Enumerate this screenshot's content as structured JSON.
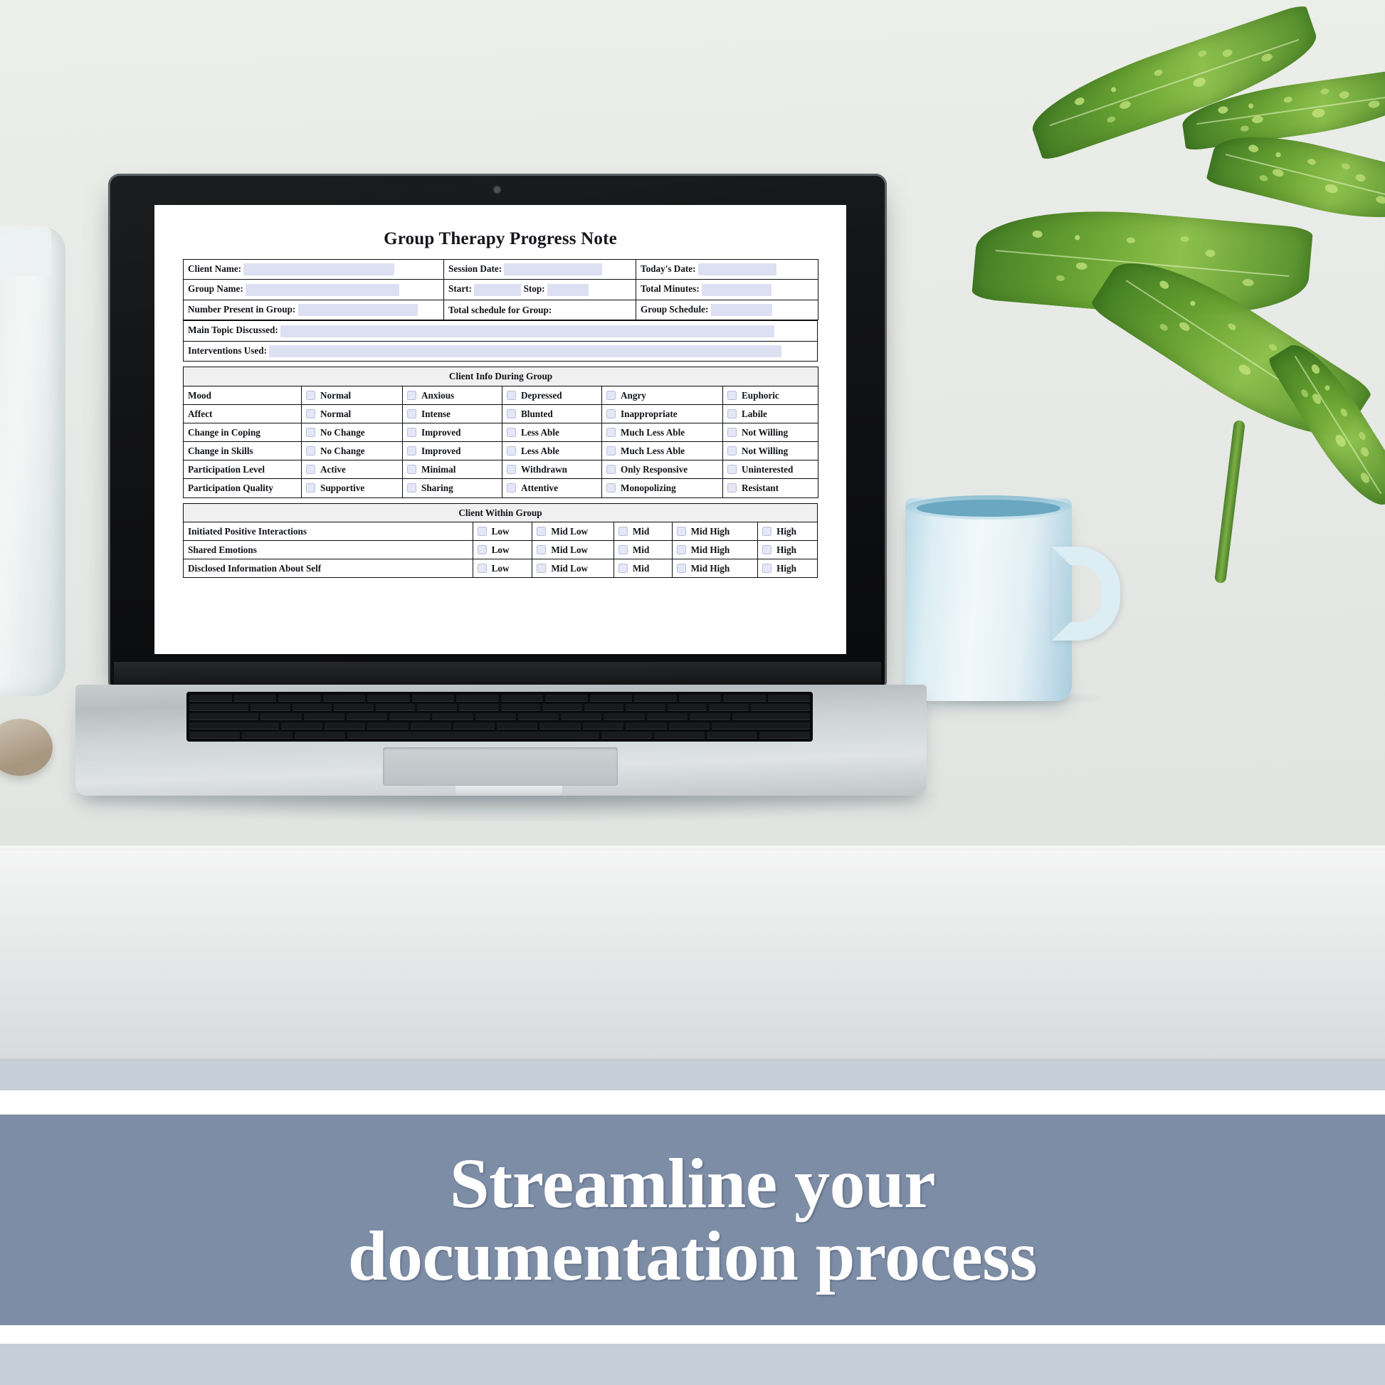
{
  "document": {
    "title": "Group Therapy Progress Note",
    "header_rows": [
      [
        {
          "label": "Client Name:",
          "type": "fill"
        },
        {
          "label": "Session Date:",
          "type": "fill"
        },
        {
          "label": "Today's Date:",
          "type": "fill"
        }
      ],
      [
        {
          "label": "Group Name:",
          "type": "fill"
        },
        {
          "label": "Start:",
          "label2": "Stop:",
          "type": "split"
        },
        {
          "label": "Total Minutes:",
          "type": "fill"
        }
      ],
      [
        {
          "label": "Number Present in Group:",
          "type": "fill"
        },
        {
          "label": "Total schedule for Group:",
          "type": "plain"
        },
        {
          "label": "Group Schedule:",
          "type": "fill"
        }
      ]
    ],
    "wide_rows": [
      {
        "label": "Main Topic Discussed:"
      },
      {
        "label": "Interventions Used:"
      }
    ],
    "section_during": {
      "heading": "Client Info During Group",
      "rows": [
        {
          "label": "Mood",
          "options": [
            "Normal",
            "Anxious",
            "Depressed",
            "Angry",
            "Euphoric"
          ]
        },
        {
          "label": "Affect",
          "options": [
            "Normal",
            "Intense",
            "Blunted",
            "Inappropriate",
            "Labile"
          ]
        },
        {
          "label": "Change in Coping",
          "options": [
            "No Change",
            "Improved",
            "Less Able",
            "Much Less Able",
            "Not Willing"
          ]
        },
        {
          "label": "Change in Skills",
          "options": [
            "No Change",
            "Improved",
            "Less Able",
            "Much Less Able",
            "Not Willing"
          ]
        },
        {
          "label": "Participation Level",
          "options": [
            "Active",
            "Minimal",
            "Withdrawn",
            "Only Responsive",
            "Uninterested"
          ]
        },
        {
          "label": "Participation Quality",
          "options": [
            "Supportive",
            "Sharing",
            "Attentive",
            "Monopolizing",
            "Resistant"
          ]
        }
      ]
    },
    "section_within": {
      "heading": "Client Within Group",
      "scale": [
        "Low",
        "Mid Low",
        "Mid",
        "Mid High",
        "High"
      ],
      "rows": [
        {
          "label": "Initiated Positive Interactions"
        },
        {
          "label": "Shared Emotions"
        },
        {
          "label": "Disclosed Information About Self"
        }
      ]
    }
  },
  "banner": {
    "line1": "Streamline your",
    "line2": "documentation process",
    "background_color": "#7d8da6",
    "text_color": "#ffffff",
    "accent_band_color": "#c6ced8"
  },
  "scene": {
    "field_fill_color": "#dde0f2",
    "section_header_color": "#f0f0f0",
    "mug_color": "#dcedf4",
    "wall_color": "#eceeea",
    "desk_color": "#f4f5f4"
  }
}
